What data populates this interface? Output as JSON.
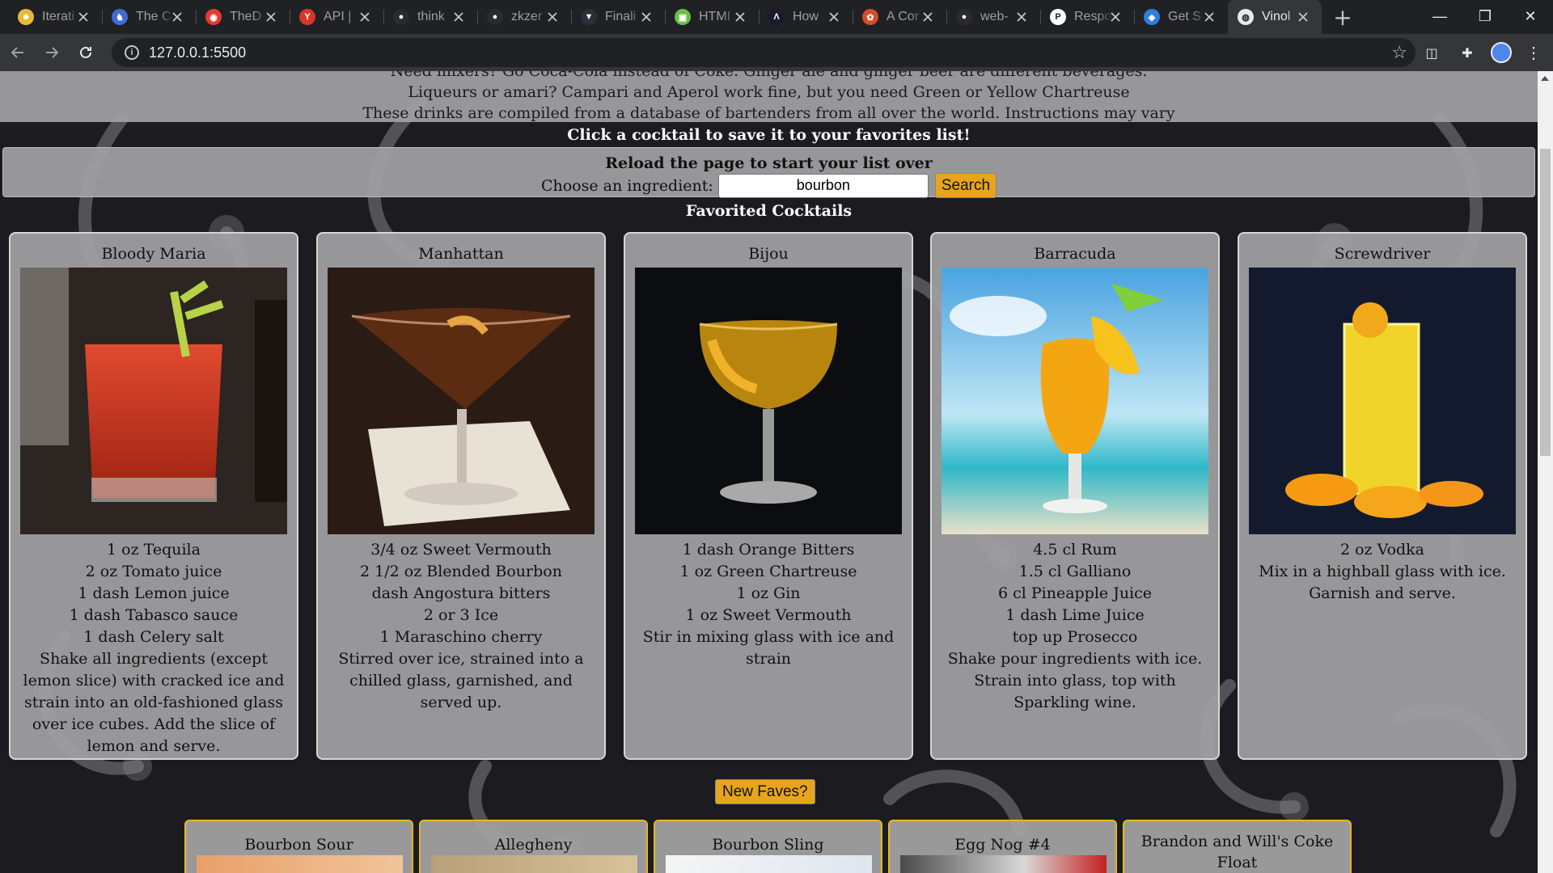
{
  "browser": {
    "tabs": [
      {
        "title": "Iterati",
        "active": false,
        "fav_color": "#e8b93a",
        "fav_glyph": "☻"
      },
      {
        "title": "The C",
        "active": false,
        "fav_color": "#3f6ad8",
        "fav_glyph": "♞"
      },
      {
        "title": "TheD",
        "active": false,
        "fav_color": "#e53935",
        "fav_glyph": "◉"
      },
      {
        "title": "API |",
        "active": false,
        "fav_color": "#d9362b",
        "fav_glyph": "Y"
      },
      {
        "title": "think",
        "active": false,
        "fav_color": "#2b2b2b",
        "fav_glyph": "●"
      },
      {
        "title": "zkzer",
        "active": false,
        "fav_color": "#2b2b2b",
        "fav_glyph": "●"
      },
      {
        "title": "Finali",
        "active": false,
        "fav_color": "#2a2f3a",
        "fav_glyph": "▼"
      },
      {
        "title": "HTMI",
        "active": false,
        "fav_color": "#6abf46",
        "fav_glyph": "▣"
      },
      {
        "title": "How",
        "active": false,
        "fav_color": "#1a1a2e",
        "fav_glyph": "Λ"
      },
      {
        "title": "A Cor",
        "active": false,
        "fav_color": "#d84a2a",
        "fav_glyph": "✿"
      },
      {
        "title": "web-",
        "active": false,
        "fav_color": "#2b2b2b",
        "fav_glyph": "●"
      },
      {
        "title": "Respo",
        "active": false,
        "fav_color": "#ffffff",
        "fav_glyph": "P"
      },
      {
        "title": "Get S",
        "active": false,
        "fav_color": "#2f7de1",
        "fav_glyph": "◈"
      },
      {
        "title": "Vinol",
        "active": true,
        "fav_color": "#e8eaed",
        "fav_glyph": "◍"
      }
    ],
    "url": "127.0.0.1:5500"
  },
  "info": {
    "line_cut": "Need mixers? Go Coca-Cola instead of Coke. Ginger ale and ginger beer are different beverages.",
    "line1": "Liqueurs or amari? Campari and Aperol work fine, but you need Green or Yellow Chartreuse",
    "line2": "These drinks are compiled from a database of bartenders from all over the world. Instructions may vary"
  },
  "save_hint": "Click a cocktail to save it to your favorites list!",
  "search": {
    "reload_text": "Reload the page to start your list over",
    "label": "Choose an ingredient:",
    "value": "bourbon",
    "button": "Search"
  },
  "favorites_title": "Favorited Cocktails",
  "favorites": [
    {
      "name": "Bloody Maria",
      "lines": [
        "1 oz Tequila",
        "2 oz Tomato juice",
        "1 dash Lemon juice",
        "1 dash Tabasco sauce",
        "1 dash Celery salt",
        "Shake all ingredients (except lemon slice) with cracked ice and strain into an old-fashioned glass over ice cubes. Add the slice of lemon and serve."
      ]
    },
    {
      "name": "Manhattan",
      "lines": [
        "3/4 oz Sweet Vermouth",
        "2 1/2 oz Blended Bourbon",
        "dash Angostura bitters",
        "2 or 3 Ice",
        "1 Maraschino cherry",
        "Stirred over ice, strained into a chilled glass, garnished, and served up."
      ]
    },
    {
      "name": "Bijou",
      "lines": [
        "1 dash Orange Bitters",
        "1 oz Green Chartreuse",
        "1 oz Gin",
        "1 oz Sweet Vermouth",
        "Stir in mixing glass with ice and strain"
      ]
    },
    {
      "name": "Barracuda",
      "lines": [
        "4.5 cl Rum",
        "1.5 cl Galliano",
        "6 cl Pineapple Juice",
        "1 dash Lime Juice",
        "top up Prosecco",
        "Shake pour ingredients with ice. Strain into glass, top with Sparkling wine."
      ]
    },
    {
      "name": "Screwdriver",
      "lines": [
        "2 oz Vodka",
        "Mix in a highball glass with ice. Garnish and serve."
      ]
    }
  ],
  "new_faves_button": "New Faves?",
  "results": [
    "Bourbon Sour",
    "Allegheny",
    "Bourbon Sling",
    "Egg Nog #4",
    "Brandon and Will's Coke Float"
  ]
}
